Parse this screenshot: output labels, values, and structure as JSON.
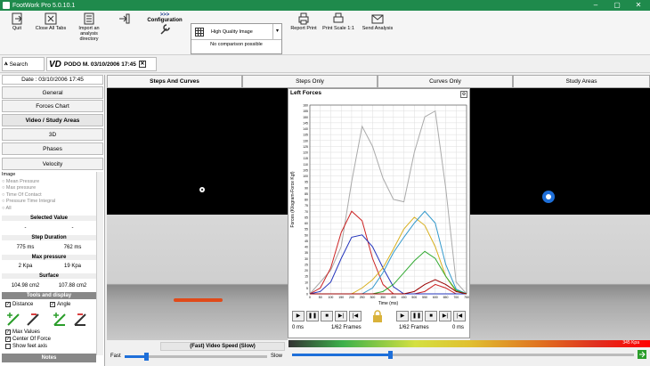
{
  "window": {
    "title": "FootWork Pro 5.0.10.1"
  },
  "toolbar": {
    "quit": "Quit",
    "close_all": "Close All Tabs",
    "import_analysis": "Import an analysis directory",
    "import_footwork": "FootWork analysis importation",
    "configuration": "Configuration",
    "quality_select": "High Quality Image",
    "no_comparison": "No comparison possible",
    "report_print": "Report Print",
    "print_scale": "Print Scale 1:1",
    "send_analysis": "Send Analysis"
  },
  "tabs": {
    "search": "Search",
    "patient": "PODO M. 03/10/2006 17:45"
  },
  "left": {
    "date": "Date : 03/10/2006 17:45",
    "buttons": [
      "General",
      "Forces Chart",
      "Video / Study Areas",
      "3D",
      "Phases",
      "Velocity"
    ],
    "image_label": "Image",
    "options": [
      "Mean Pressure",
      "Max pressure",
      "Time Of Contact",
      "Pressure Time Integral",
      "All"
    ],
    "selected_value": "Selected Value",
    "sel_vals": [
      "-",
      "-"
    ],
    "step_duration": "Step Duration",
    "dur_vals": [
      "775 ms",
      "762 ms"
    ],
    "max_pressure": "Max pressure",
    "mp_vals": [
      "2 Kpa",
      "19 Kpa"
    ],
    "surface": "Surface",
    "surf_vals": [
      "104.98 cm2",
      "107.88 cm2"
    ],
    "tools": "Tools and display",
    "distance": "Distance",
    "angle": "Angle",
    "max_values": "Max Values",
    "center_force": "Center Of Force",
    "show_feet": "Show feet axis",
    "notes": "Notes"
  },
  "view_tabs": [
    "Steps And Curves",
    "Steps Only",
    "Curves Only",
    "Study Areas"
  ],
  "chart": {
    "panel_title": "Left Forces",
    "frames_left": "1/62 Frames",
    "frames_right": "1/62 Frames",
    "ms_left": "0 ms",
    "ms_right": "0 ms",
    "pressure_max": "345 Kpa"
  },
  "speed": {
    "label": "(Fast)  Video Speed  (Slow)",
    "fast": "Fast",
    "slow": "Slow"
  },
  "chart_data": {
    "type": "line",
    "title": "Left Forces",
    "xlabel": "Time (ms)",
    "ylabel": "Forces (Kilogram-Force Kgf)",
    "xlim": [
      0,
      750
    ],
    "ylim": [
      0,
      160
    ],
    "x": [
      0,
      50,
      100,
      150,
      200,
      250,
      300,
      350,
      400,
      450,
      500,
      550,
      600,
      650,
      700,
      750
    ],
    "xticks": [
      "0",
      "50",
      "100",
      "150",
      "200",
      "250",
      "300",
      "350",
      "400",
      "450",
      "500",
      "550",
      "600",
      "650",
      "700",
      "750"
    ],
    "yticks": [
      "0",
      "5",
      "10",
      "15",
      "20",
      "25",
      "30",
      "35",
      "40",
      "45",
      "50",
      "55",
      "60",
      "65",
      "70",
      "75",
      "80",
      "85",
      "90",
      "95",
      "100",
      "105",
      "110",
      "115",
      "120",
      "125",
      "130",
      "135",
      "140",
      "145",
      "150",
      "155",
      "160"
    ],
    "series": [
      {
        "color": "#aaaaaa",
        "values": [
          0,
          10,
          20,
          40,
          95,
          142,
          125,
          98,
          80,
          78,
          120,
          150,
          155,
          90,
          10,
          0
        ]
      },
      {
        "color": "#cc2222",
        "values": [
          0,
          5,
          22,
          52,
          70,
          62,
          30,
          8,
          0,
          0,
          0,
          2,
          8,
          5,
          0,
          0
        ]
      },
      {
        "color": "#2233bb",
        "values": [
          0,
          2,
          10,
          30,
          48,
          50,
          40,
          22,
          6,
          0,
          0,
          0,
          0,
          0,
          0,
          0
        ]
      },
      {
        "color": "#d8b020",
        "values": [
          0,
          0,
          0,
          0,
          0,
          5,
          12,
          22,
          38,
          55,
          65,
          58,
          40,
          15,
          2,
          0
        ]
      },
      {
        "color": "#3399cc",
        "values": [
          0,
          0,
          0,
          0,
          0,
          0,
          5,
          18,
          35,
          48,
          60,
          70,
          60,
          25,
          4,
          0
        ]
      },
      {
        "color": "#33aa33",
        "values": [
          0,
          0,
          0,
          0,
          0,
          0,
          0,
          2,
          8,
          18,
          28,
          36,
          30,
          15,
          3,
          0
        ]
      },
      {
        "color": "#990000",
        "values": [
          0,
          0,
          0,
          0,
          0,
          0,
          0,
          0,
          0,
          0,
          2,
          8,
          12,
          8,
          2,
          0
        ]
      }
    ]
  }
}
